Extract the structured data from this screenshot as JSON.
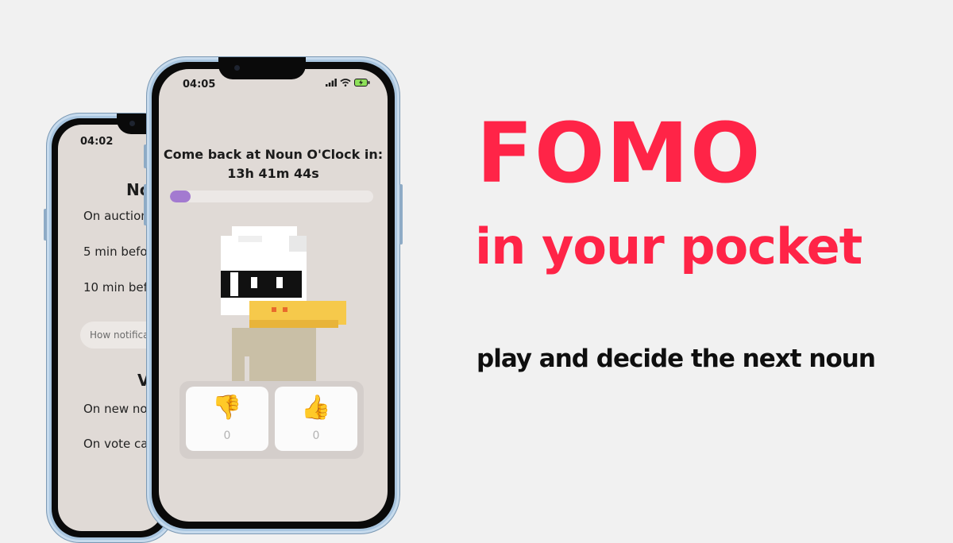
{
  "back_phone": {
    "time": "04:02",
    "title": "Noti",
    "items": [
      "On auction e",
      "5 min before",
      "10 min befor"
    ],
    "pill": "How notifica",
    "section_title": "Vib",
    "vibe_items": [
      "On new noun",
      "On vote cast"
    ]
  },
  "front_phone": {
    "time": "04:05",
    "countdown_label": "Come back at Noun O'Clock in:",
    "countdown_value": "13h 41m 44s",
    "progress": 0.1,
    "vote_down": {
      "emoji": "👎",
      "count": "0"
    },
    "vote_up": {
      "emoji": "👍",
      "count": "0"
    }
  },
  "headline": {
    "line1": "FOMO",
    "line2": "in your pocket",
    "tagline": "play and decide the next noun"
  },
  "colors": {
    "accent": "#ff2447",
    "progress": "#a37ad0",
    "screen_bg": "#e0dad6",
    "phone_frame": "#a9c6e0"
  },
  "icons": [
    "signal-icon",
    "wifi-icon",
    "battery-icon",
    "thumbs-down-icon",
    "thumbs-up-icon"
  ]
}
